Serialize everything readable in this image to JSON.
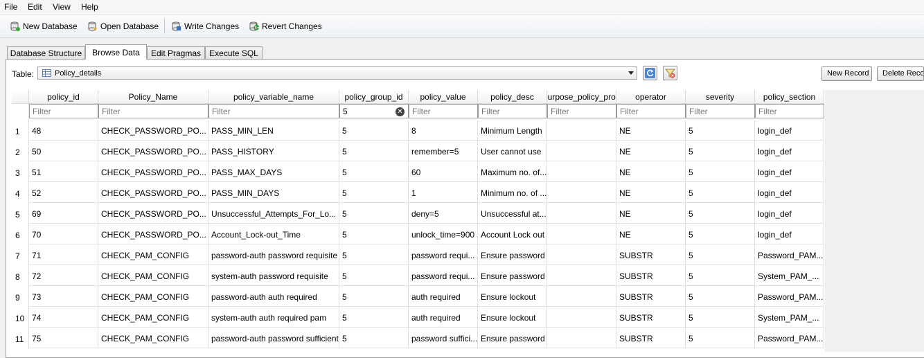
{
  "menu": [
    "File",
    "Edit",
    "View",
    "Help"
  ],
  "toolbar": {
    "new_db": "New Database",
    "open_db": "Open Database",
    "write": "Write Changes",
    "revert": "Revert Changes"
  },
  "tabs": [
    "Database Structure",
    "Browse Data",
    "Edit Pragmas",
    "Execute SQL"
  ],
  "active_tab": "Browse Data",
  "table_selector": {
    "label": "Table:",
    "value": "Policy_details"
  },
  "buttons": {
    "new_record": "New Record",
    "delete_record": "Delete Record"
  },
  "grid": {
    "columns": [
      "policy_id",
      "Policy_Name",
      "policy_variable_name",
      "policy_group_id",
      "policy_value",
      "policy_desc",
      "purpose_policy_pro",
      "operator",
      "severity",
      "policy_section"
    ],
    "filter_placeholder": "Filter",
    "filters": [
      "",
      "",
      "",
      "5",
      "",
      "",
      "",
      "",
      "",
      ""
    ],
    "rows": [
      [
        "48",
        "CHECK_PASSWORD_POLICY",
        "PASS_MIN_LEN",
        "5",
        "8",
        "Minimum Length",
        "",
        "NE",
        "5",
        "login_def"
      ],
      [
        "50",
        "CHECK_PASSWORD_POLICY",
        "PASS_HISTORY",
        "5",
        "remember=5",
        "User cannot use",
        "",
        "NE",
        "5",
        "login_def"
      ],
      [
        "51",
        "CHECK_PASSWORD_POLICY",
        "PASS_MAX_DAYS",
        "5",
        "60",
        "Maximum no. of days",
        "",
        "NE",
        "5",
        "login_def"
      ],
      [
        "52",
        "CHECK_PASSWORD_POLICY",
        "PASS_MIN_DAYS",
        "5",
        "1",
        "Minimum no. of days",
        "",
        "NE",
        "5",
        "login_def"
      ],
      [
        "69",
        "CHECK_PASSWORD_POLICY",
        "Unsuccessful_Attempts_For_Lockout",
        "5",
        "deny=5",
        "Unsuccessful attempts",
        "",
        "NE",
        "5",
        "login_def"
      ],
      [
        "70",
        "CHECK_PASSWORD_POLICY",
        "Account_Lock-out_Time",
        "5",
        "unlock_time=900",
        "Account Lock out",
        "",
        "NE",
        "5",
        "login_def"
      ],
      [
        "71",
        "CHECK_PAM_CONFIG",
        "password-auth password requisite",
        "5",
        "password requisite",
        "Ensure password",
        "",
        "SUBSTR",
        "5",
        "Password_PAM_Config"
      ],
      [
        "72",
        "CHECK_PAM_CONFIG",
        "system-auth password requisite",
        "5",
        "password requisite",
        "Ensure password",
        "",
        "SUBSTR",
        "5",
        "System_PAM_Config"
      ],
      [
        "73",
        "CHECK_PAM_CONFIG",
        "password-auth auth required",
        "5",
        "auth required",
        "Ensure lockout",
        "",
        "SUBSTR",
        "5",
        "Password_PAM_Config"
      ],
      [
        "74",
        "CHECK_PAM_CONFIG",
        "system-auth auth required pam",
        "5",
        "auth required",
        "Ensure lockout",
        "",
        "SUBSTR",
        "5",
        "System_PAM_Config"
      ],
      [
        "75",
        "CHECK_PAM_CONFIG",
        "password-auth password sufficient",
        "5",
        "password sufficient",
        "Ensure password",
        "",
        "SUBSTR",
        "5",
        "Password_PAM_Config"
      ]
    ]
  }
}
